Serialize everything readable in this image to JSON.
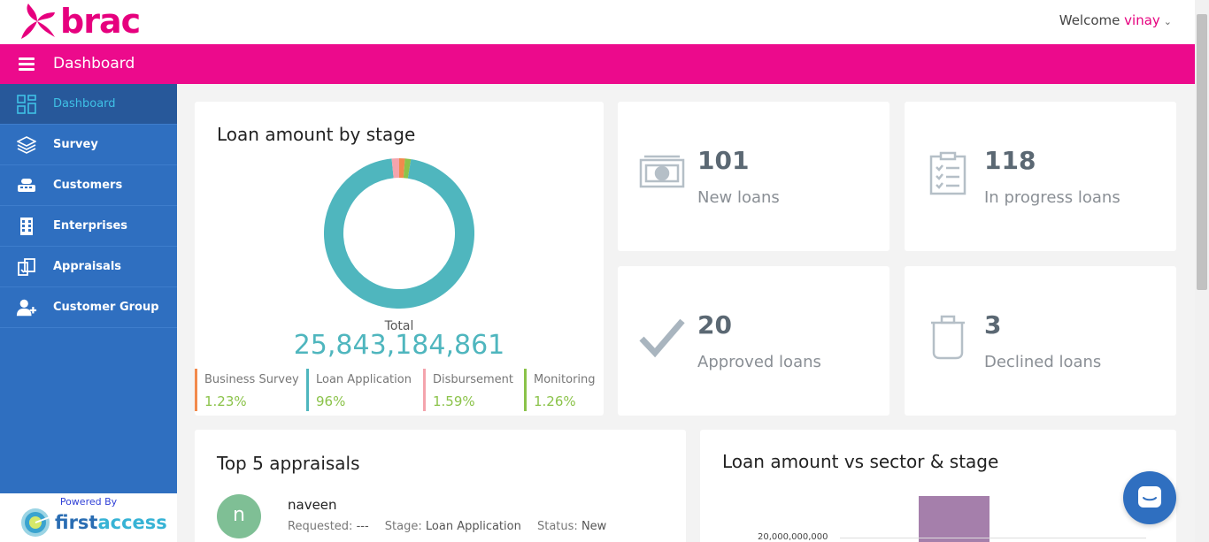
{
  "brand": {
    "logo_text": "brac",
    "accent": "#e6007e"
  },
  "header": {
    "welcome": "Welcome",
    "user": "vinay",
    "page_title": "Dashboard"
  },
  "sidebar": {
    "items": [
      {
        "label": "Dashboard",
        "icon": "grid-icon",
        "active": true
      },
      {
        "label": "Survey",
        "icon": "layers-icon"
      },
      {
        "label": "Customers",
        "icon": "customers-icon"
      },
      {
        "label": "Enterprises",
        "icon": "building-icon"
      },
      {
        "label": "Appraisals",
        "icon": "appraisals-icon"
      },
      {
        "label": "Customer Group",
        "icon": "group-icon"
      }
    ],
    "powered_by": "Powered By",
    "powered_logo_a": "first",
    "powered_logo_b": "access"
  },
  "loan_by_stage": {
    "title": "Loan amount by stage",
    "total_label": "Total",
    "total_value": "25,843,184,861",
    "stages": [
      {
        "name": "Business Survey",
        "pct": "1.23%",
        "value": 1.23,
        "color": "#f28a4c"
      },
      {
        "name": "Loan Application",
        "pct": "96%",
        "value": 95.92,
        "color": "#4fb6be"
      },
      {
        "name": "Disbursement",
        "pct": "1.59%",
        "value": 1.59,
        "color": "#f4a4ad"
      },
      {
        "name": "Monitoring",
        "pct": "1.26%",
        "value": 1.26,
        "color": "#8bc34a"
      }
    ]
  },
  "stats": [
    {
      "number": "101",
      "label": "New loans",
      "icon": "cash-icon"
    },
    {
      "number": "118",
      "label": "In progress loans",
      "icon": "clipboard-icon"
    },
    {
      "number": "20",
      "label": "Approved loans",
      "icon": "checkmark-icon"
    },
    {
      "number": "3",
      "label": "Declined loans",
      "icon": "trash-icon"
    }
  ],
  "top_appraisals": {
    "title": "Top 5 appraisals",
    "items": [
      {
        "initial": "n",
        "name": "naveen",
        "requested_label": "Requested:",
        "requested": "---",
        "stage_label": "Stage:",
        "stage": "Loan Application",
        "status_label": "Status:",
        "status": "New"
      }
    ]
  },
  "sector_chart": {
    "title": "Loan amount vs sector & stage",
    "ytick": "20,000,000,000"
  }
}
